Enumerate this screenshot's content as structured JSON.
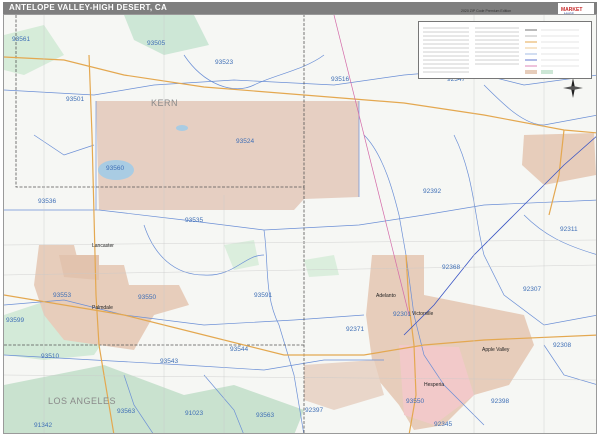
{
  "header": {
    "title": "ANTELOPE VALLEY-HIGH DESERT, CA",
    "edition": "2020 ZIP Code Premium Edition"
  },
  "colors": {
    "title_bar": "#7f7f7f",
    "urban_area": "#e6c7b4",
    "urban_alt": "#f2c9c9",
    "park_green": "#cde7d6",
    "water": "#a9cce3",
    "zip_boundary": "#6b8fd6",
    "highway": "#e4a850",
    "county_line": "#444444",
    "rail": "#3a55c4"
  },
  "icons": {
    "compass": "compass-rose-icon",
    "logo": "market-maps-logo"
  },
  "labels": {
    "kern": "KERN",
    "los_angeles": "LOS ANGELES",
    "lancaster": "Lancaster",
    "palmdale": "Palmdale",
    "victorville": "Victorville",
    "hesperia": "Hesperia",
    "apple_valley": "Apple Valley",
    "adelanto": "Adelanto"
  },
  "zip_codes": [
    {
      "id": "z93561",
      "code": "93561"
    },
    {
      "id": "z93505",
      "code": "93505"
    },
    {
      "id": "z93523",
      "code": "93523"
    },
    {
      "id": "z93501",
      "code": "93501"
    },
    {
      "id": "z93516",
      "code": "93516"
    },
    {
      "id": "z92347",
      "code": "92347"
    },
    {
      "id": "z93524",
      "code": "93524"
    },
    {
      "id": "z93560",
      "code": "93560"
    },
    {
      "id": "z93536",
      "code": "93536"
    },
    {
      "id": "z93535",
      "code": "93535"
    },
    {
      "id": "z92392",
      "code": "92392"
    },
    {
      "id": "z92368",
      "code": "92368"
    },
    {
      "id": "z92311",
      "code": "92311"
    },
    {
      "id": "z92307",
      "code": "92307"
    },
    {
      "id": "z93553",
      "code": "93553"
    },
    {
      "id": "z93550",
      "code": "93550"
    },
    {
      "id": "z93591",
      "code": "93591"
    },
    {
      "id": "z93599",
      "code": "93599"
    },
    {
      "id": "z92301",
      "code": "92301"
    },
    {
      "id": "z92371",
      "code": "92371"
    },
    {
      "id": "z93510",
      "code": "93510"
    },
    {
      "id": "z93543",
      "code": "93543"
    },
    {
      "id": "z93544",
      "code": "93544"
    },
    {
      "id": "z92308",
      "code": "92308"
    },
    {
      "id": "z93563",
      "code": "93563"
    },
    {
      "id": "z91023",
      "code": "91023"
    },
    {
      "id": "z93563b",
      "code": "93563"
    },
    {
      "id": "z92397",
      "code": "92397"
    },
    {
      "id": "z92345",
      "code": "92345"
    },
    {
      "id": "z92398",
      "code": "92398"
    },
    {
      "id": "z91342",
      "code": "91342"
    },
    {
      "id": "z93550b",
      "code": "93550"
    }
  ]
}
